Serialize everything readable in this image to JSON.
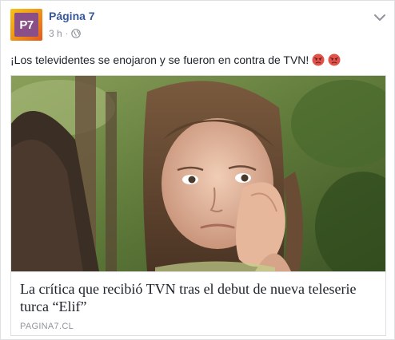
{
  "post": {
    "page_name": "Página 7",
    "avatar_text": "P7",
    "timestamp": "3 h",
    "separator": "·",
    "privacy_icon": "globe-icon",
    "options_icon": "chevron-down-icon",
    "message": "¡Los televidentes se enojaron y se fueron en contra de TVN!",
    "reaction_emojis": [
      "angry-face-icon",
      "angry-face-icon"
    ],
    "link": {
      "title": "La crítica que recibió TVN tras el debut de nueva teleserie turca “Elif”",
      "domain": "PAGINA7.CL"
    }
  },
  "colors": {
    "link_blue": "#365899",
    "meta_gray": "#90949c",
    "text": "#1d2129",
    "border": "#dddfe2",
    "avatar_purple": "#8a4f86",
    "avatar_orange": "#f09a16",
    "emoji_red": "#e0524a"
  }
}
